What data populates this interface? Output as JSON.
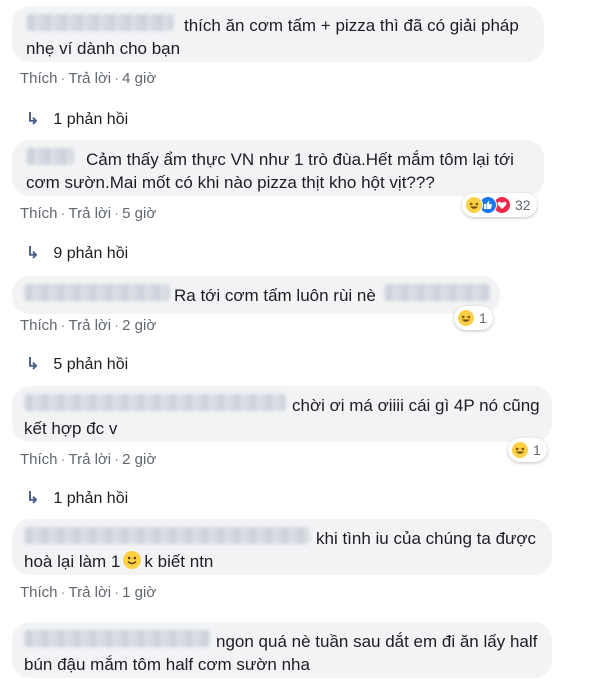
{
  "comments": [
    {
      "text": "thích ăn cơm tấm + pizza thì đã có giải pháp nhẹ ví dành cho bạn",
      "like": "Thích",
      "reply": "Trả lời",
      "time": "4 giờ",
      "replies": "1 phản hồi"
    },
    {
      "text": "Cảm thấy ẩm thực VN như 1 trò đùa.Hết mắm tôm lại tới cơm sườn.Mai mốt có khi nào pizza thịt kho hột vịt???",
      "like": "Thích",
      "reply": "Trả lời",
      "time": "5 giờ",
      "reaction_count": "32",
      "reaction_icons": [
        "haha-icon",
        "like-icon",
        "love-icon"
      ],
      "replies": "9 phản hồi"
    },
    {
      "text": "Ra tới cơm tấm luôn rùi nè",
      "like": "Thích",
      "reply": "Trả lời",
      "time": "2 giờ",
      "reaction_count": "1",
      "reaction_icons": [
        "haha-icon"
      ],
      "replies": "5 phản hồi"
    },
    {
      "text": "chời ơi má ơiiii cái gì 4P nó cũng kết hợp đc v",
      "like": "Thích",
      "reply": "Trả lời",
      "time": "2 giờ",
      "reaction_count": "1",
      "reaction_icons": [
        "haha-icon"
      ],
      "replies": "1 phản hồi"
    },
    {
      "text_before": "khi tình iu của chúng ta được hoà lại làm 1",
      "text_after": "k biết ntn",
      "emoji": "smiley-icon",
      "like": "Thích",
      "reply": "Trả lời",
      "time": "1 giờ"
    },
    {
      "text": "ngon quá nè tuần sau dắt em đi ăn lấy half bún đậu mắm tôm half cơm sườn nha"
    }
  ],
  "colors": {
    "bubble": "#f2f3f5",
    "meta_text": "#616770",
    "reply_arrow": "#4b5f8a",
    "haha": "#fcd043",
    "like": "#1877f2",
    "love": "#f0284a"
  }
}
